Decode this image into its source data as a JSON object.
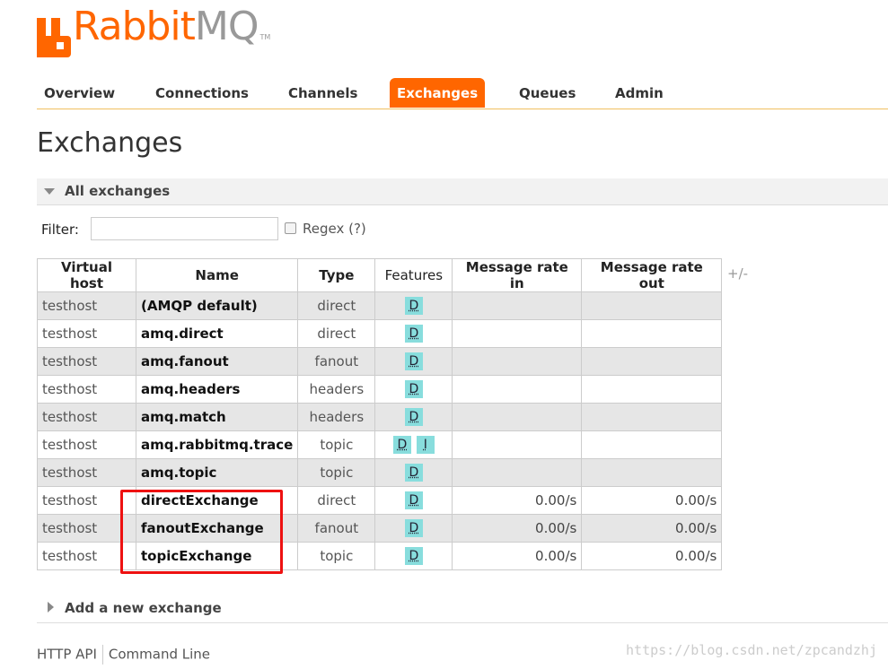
{
  "logo": {
    "rabbit": "Rabbit",
    "mq": "MQ",
    "tm": "TM"
  },
  "nav": {
    "tabs": [
      "Overview",
      "Connections",
      "Channels",
      "Exchanges",
      "Queues",
      "Admin"
    ],
    "active": "Exchanges"
  },
  "page_title": "Exchanges",
  "section": {
    "all_exchanges": "All exchanges"
  },
  "filter": {
    "label": "Filter:",
    "value": "",
    "regex_label": "Regex (?)",
    "regex_checked": false
  },
  "table": {
    "headers": [
      "Virtual host",
      "Name",
      "Type",
      "Features",
      "Message rate in",
      "Message rate out"
    ],
    "plus_minus": "+/-",
    "rows": [
      {
        "vhost": "testhost",
        "name": "(AMQP default)",
        "type": "direct",
        "features": [
          "D"
        ],
        "rate_in": "",
        "rate_out": ""
      },
      {
        "vhost": "testhost",
        "name": "amq.direct",
        "type": "direct",
        "features": [
          "D"
        ],
        "rate_in": "",
        "rate_out": ""
      },
      {
        "vhost": "testhost",
        "name": "amq.fanout",
        "type": "fanout",
        "features": [
          "D"
        ],
        "rate_in": "",
        "rate_out": ""
      },
      {
        "vhost": "testhost",
        "name": "amq.headers",
        "type": "headers",
        "features": [
          "D"
        ],
        "rate_in": "",
        "rate_out": ""
      },
      {
        "vhost": "testhost",
        "name": "amq.match",
        "type": "headers",
        "features": [
          "D"
        ],
        "rate_in": "",
        "rate_out": ""
      },
      {
        "vhost": "testhost",
        "name": "amq.rabbitmq.trace",
        "type": "topic",
        "features": [
          "D",
          "I"
        ],
        "rate_in": "",
        "rate_out": ""
      },
      {
        "vhost": "testhost",
        "name": "amq.topic",
        "type": "topic",
        "features": [
          "D"
        ],
        "rate_in": "",
        "rate_out": ""
      },
      {
        "vhost": "testhost",
        "name": "directExchange",
        "type": "direct",
        "features": [
          "D"
        ],
        "rate_in": "0.00/s",
        "rate_out": "0.00/s"
      },
      {
        "vhost": "testhost",
        "name": "fanoutExchange",
        "type": "fanout",
        "features": [
          "D"
        ],
        "rate_in": "0.00/s",
        "rate_out": "0.00/s"
      },
      {
        "vhost": "testhost",
        "name": "topicExchange",
        "type": "topic",
        "features": [
          "D"
        ],
        "rate_in": "0.00/s",
        "rate_out": "0.00/s"
      }
    ]
  },
  "add_exchange": "Add a new exchange",
  "footer": {
    "links": [
      "HTTP API",
      "Command Line"
    ]
  },
  "watermark": "https://blog.csdn.net/zpcandzhj",
  "colors": {
    "brand": "#ff6600",
    "badge": "#88dddd",
    "highlight": "#ee1111"
  }
}
